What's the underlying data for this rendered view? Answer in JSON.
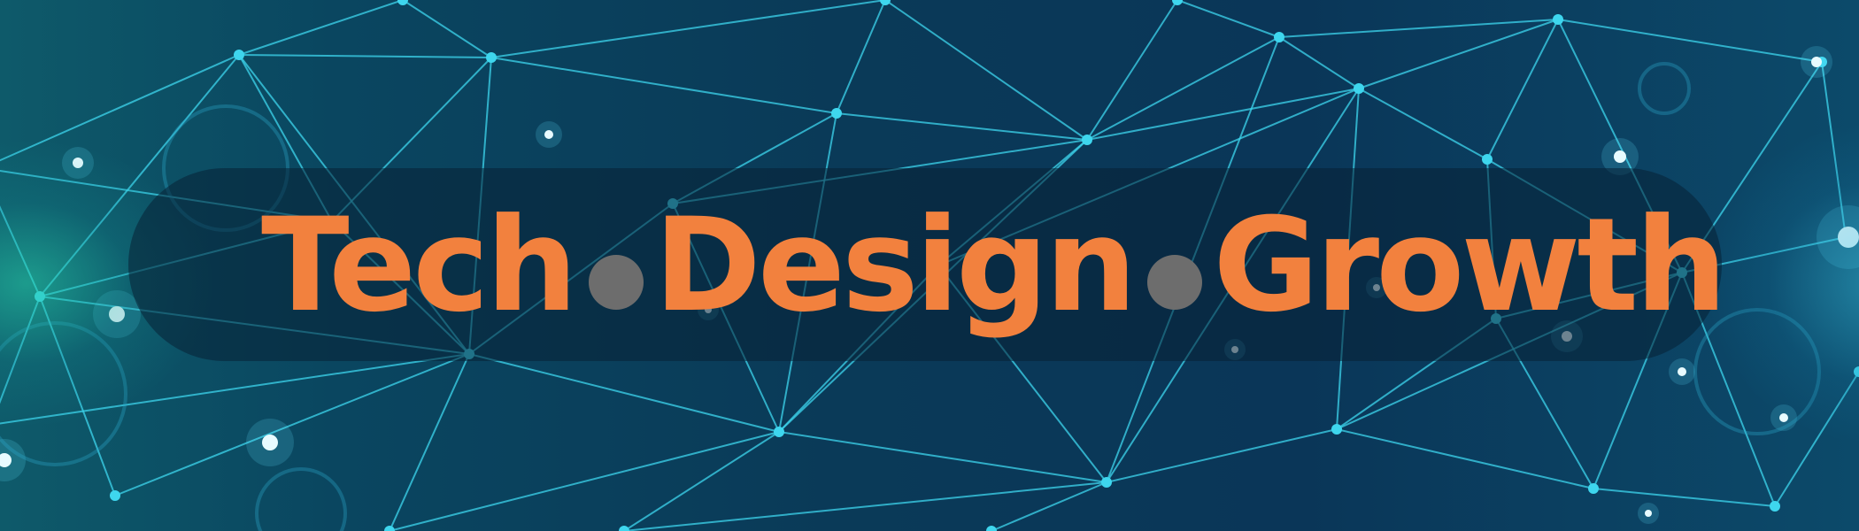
{
  "banner": {
    "words": [
      "Tech",
      "Design",
      "Growth"
    ],
    "colors": {
      "text": "#f2813e",
      "separator": "#6d6d6d",
      "background": "#0a3a58",
      "network_lines": "#3ed6ee"
    },
    "separator_icon": "circle-dot-icon",
    "background_pattern": "network-mesh"
  }
}
